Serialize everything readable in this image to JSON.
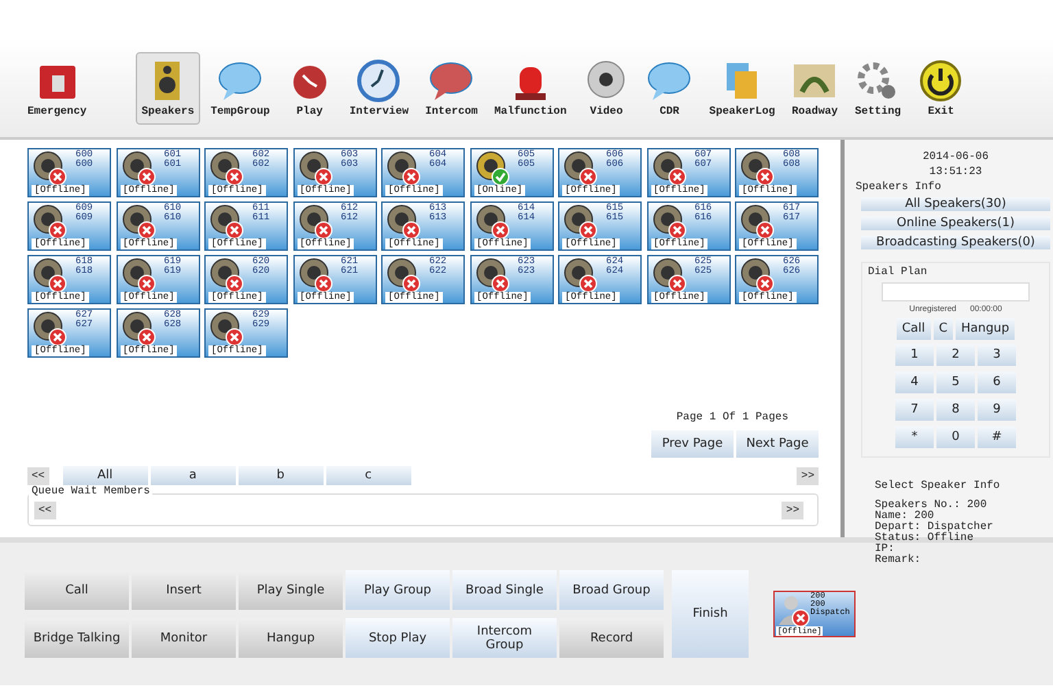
{
  "toolbar": [
    {
      "label": "Emergency",
      "selected": false
    },
    {
      "label": "Speakers",
      "selected": true
    },
    {
      "label": "TempGroup",
      "selected": false
    },
    {
      "label": "Play",
      "selected": false
    },
    {
      "label": "Interview",
      "selected": false
    },
    {
      "label": "Intercom",
      "selected": false
    },
    {
      "label": "Malfunction",
      "selected": false
    },
    {
      "label": "Video",
      "selected": false
    },
    {
      "label": "CDR",
      "selected": false
    },
    {
      "label": "SpeakerLog",
      "selected": false
    },
    {
      "label": "Roadway",
      "selected": false
    },
    {
      "label": "Setting",
      "selected": false
    },
    {
      "label": "Exit",
      "selected": false
    }
  ],
  "speakers": [
    {
      "name": "600",
      "number": "600",
      "status": "[Offline]",
      "online": false
    },
    {
      "name": "601",
      "number": "601",
      "status": "[Offline]",
      "online": false
    },
    {
      "name": "602",
      "number": "602",
      "status": "[Offline]",
      "online": false
    },
    {
      "name": "603",
      "number": "603",
      "status": "[Offline]",
      "online": false
    },
    {
      "name": "604",
      "number": "604",
      "status": "[Offline]",
      "online": false
    },
    {
      "name": "605",
      "number": "605",
      "status": "[Online]",
      "online": true
    },
    {
      "name": "606",
      "number": "606",
      "status": "[Offline]",
      "online": false
    },
    {
      "name": "607",
      "number": "607",
      "status": "[Offline]",
      "online": false
    },
    {
      "name": "608",
      "number": "608",
      "status": "[Offline]",
      "online": false
    },
    {
      "name": "609",
      "number": "609",
      "status": "[Offline]",
      "online": false
    },
    {
      "name": "610",
      "number": "610",
      "status": "[Offline]",
      "online": false
    },
    {
      "name": "611",
      "number": "611",
      "status": "[Offline]",
      "online": false
    },
    {
      "name": "612",
      "number": "612",
      "status": "[Offline]",
      "online": false
    },
    {
      "name": "613",
      "number": "613",
      "status": "[Offline]",
      "online": false
    },
    {
      "name": "614",
      "number": "614",
      "status": "[Offline]",
      "online": false
    },
    {
      "name": "615",
      "number": "615",
      "status": "[Offline]",
      "online": false
    },
    {
      "name": "616",
      "number": "616",
      "status": "[Offline]",
      "online": false
    },
    {
      "name": "617",
      "number": "617",
      "status": "[Offline]",
      "online": false
    },
    {
      "name": "618",
      "number": "618",
      "status": "[Offline]",
      "online": false
    },
    {
      "name": "619",
      "number": "619",
      "status": "[Offline]",
      "online": false
    },
    {
      "name": "620",
      "number": "620",
      "status": "[Offline]",
      "online": false
    },
    {
      "name": "621",
      "number": "621",
      "status": "[Offline]",
      "online": false
    },
    {
      "name": "622",
      "number": "622",
      "status": "[Offline]",
      "online": false
    },
    {
      "name": "623",
      "number": "623",
      "status": "[Offline]",
      "online": false
    },
    {
      "name": "624",
      "number": "624",
      "status": "[Offline]",
      "online": false
    },
    {
      "name": "625",
      "number": "625",
      "status": "[Offline]",
      "online": false
    },
    {
      "name": "626",
      "number": "626",
      "status": "[Offline]",
      "online": false
    },
    {
      "name": "627",
      "number": "627",
      "status": "[Offline]",
      "online": false
    },
    {
      "name": "628",
      "number": "628",
      "status": "[Offline]",
      "online": false
    },
    {
      "name": "629",
      "number": "629",
      "status": "[Offline]",
      "online": false
    }
  ],
  "pager": {
    "info": "Page 1 Of 1 Pages",
    "prev": "Prev Page",
    "next": "Next Page"
  },
  "group_tabs": {
    "left": "<<",
    "right": ">>",
    "tabs": [
      "All",
      "a",
      "b",
      "c"
    ]
  },
  "queue": {
    "title": "Queue Wait Members",
    "left": "<<",
    "right": ">>"
  },
  "actions": [
    {
      "label": "Call",
      "kind": "plain"
    },
    {
      "label": "Insert",
      "kind": "plain"
    },
    {
      "label": "Play Single",
      "kind": "plain"
    },
    {
      "label": "Play Group",
      "kind": "blue"
    },
    {
      "label": "Broad Single",
      "kind": "blue"
    },
    {
      "label": "Broad Group",
      "kind": "blue"
    },
    {
      "label": "Bridge Talking",
      "kind": "plain"
    },
    {
      "label": "Monitor",
      "kind": "plain"
    },
    {
      "label": "Hangup",
      "kind": "plain"
    },
    {
      "label": "Stop Play",
      "kind": "blue"
    },
    {
      "label": "Intercom Group",
      "kind": "blue"
    },
    {
      "label": "Record",
      "kind": "plain"
    }
  ],
  "finish": "Finish",
  "dispatcher": {
    "name": "200",
    "number": "200",
    "depart": "Dispatch",
    "status": "[Offline]",
    "online": false
  },
  "side": {
    "date": "2014-06-06",
    "time": "13:51:23",
    "info_title": "Speakers Info",
    "filters": [
      "All Speakers(30)",
      "Online Speakers(1)",
      "Broadcasting Speakers(0)"
    ],
    "dial_title": "Dial Plan",
    "reg": "Unregistered",
    "timer": "00:00:00",
    "controls": [
      "Call",
      "C",
      "Hangup"
    ],
    "keys": [
      "1",
      "2",
      "3",
      "4",
      "5",
      "6",
      "7",
      "8",
      "9",
      "*",
      "0",
      "#"
    ],
    "select_title": "Select Speaker Info",
    "details": [
      "Speakers No.: 200",
      "Name: 200",
      "Depart: Dispatcher",
      "Status: Offline",
      "IP:",
      "Remark:"
    ]
  }
}
